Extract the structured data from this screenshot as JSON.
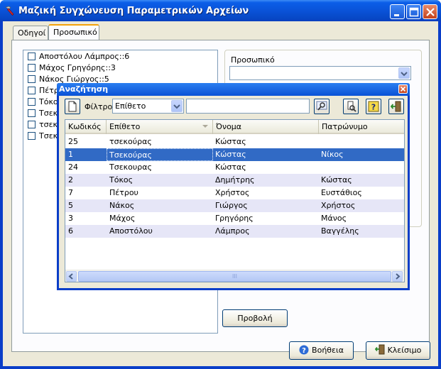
{
  "window": {
    "title": "Μαζική Συγχώνευση Παραμετρικών Αρχείων"
  },
  "tabs": [
    {
      "label": "Οδηγοί",
      "active": false
    },
    {
      "label": "Προσωπικό",
      "active": true
    }
  ],
  "checklist": {
    "items": [
      "Αποστόλου Λάμπρος::6",
      "Μάχος Γρηγόρης::3",
      "Νάκος Γιώργος::5",
      "Πέτρ",
      "Τόκο",
      "Τσεκ",
      "τσεκ",
      "Τσεκ"
    ]
  },
  "right_panel": {
    "label": "Προσωπικό",
    "combo_value": ""
  },
  "buttons": {
    "preview": "Προβολή",
    "help": "Βοήθεια",
    "close": "Κλείσιμο"
  },
  "search_dialog": {
    "title": "Αναζήτηση",
    "filter_label": "Φίλτρο",
    "filter_value": "Επίθετο",
    "search_text": "",
    "columns": [
      "Κωδικός",
      "Επίθετο",
      "Όνομα",
      "Πατρώνυμο"
    ],
    "rows": [
      {
        "code": "25",
        "surname": "τσεκούρας",
        "name": "Κώστας",
        "patronymic": ""
      },
      {
        "code": "1",
        "surname": "Τσεκούρας",
        "name": "Κώστας",
        "patronymic": "Νίκος"
      },
      {
        "code": "24",
        "surname": "Τσεκουρας",
        "name": "Κώστας",
        "patronymic": ""
      },
      {
        "code": "2",
        "surname": "Τόκος",
        "name": "Δημήτρης",
        "patronymic": "Κώστας"
      },
      {
        "code": "7",
        "surname": "Πέτρου",
        "name": "Χρήστος",
        "patronymic": "Ευστάθιος"
      },
      {
        "code": "5",
        "surname": "Νάκος",
        "name": "Γιώργος",
        "patronymic": "Χρήστος"
      },
      {
        "code": "3",
        "surname": "Μάχος",
        "name": "Γρηγόρης",
        "patronymic": "Μάνος"
      },
      {
        "code": "6",
        "surname": "Αποστόλου",
        "name": "Λάμπρος",
        "patronymic": "Βαγγέλης"
      }
    ],
    "selected_row": 1,
    "scroll_mark": "III"
  },
  "colors": {
    "titlebar": "#0a53d8",
    "selection": "#316ac5",
    "row_alt": "#e6e6f7",
    "window_face": "#ece9d8"
  },
  "icons": {
    "app": "hammer-icon",
    "minimize": "minimize-icon",
    "maximize": "maximize-icon",
    "close": "close-icon",
    "new": "new-document-icon",
    "search": "search-icon",
    "find_person": "find-person-icon",
    "help": "help-icon",
    "exit": "exit-door-icon"
  }
}
